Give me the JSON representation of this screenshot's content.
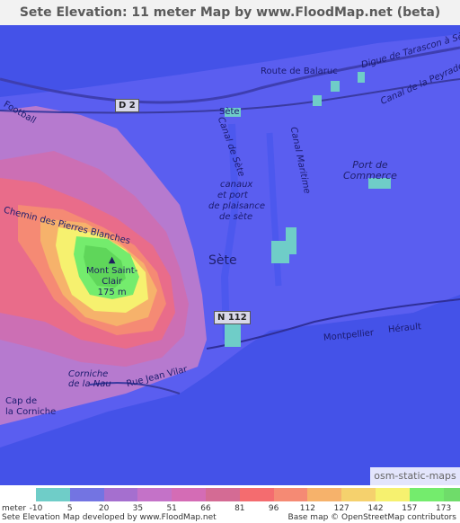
{
  "title": "Sete Elevation: 11 meter Map by www.FloodMap.net (beta)",
  "map": {
    "labels": {
      "route_balaruc": "Route de Balaruc",
      "digue_tarascon": "Digue de Tarascon à Sète",
      "canal_peyrade": "Canal de la Peyrade",
      "d2": "D 2",
      "sete_top": "Sète",
      "football": "Football",
      "canal_de_sete": "Canal de Sète",
      "canal_maritime": "Canal Maritime",
      "canaux": "canaux",
      "et_port": "et port",
      "de_plaisance": "de plaisance",
      "de_sete": "de sète",
      "port_line1": "Port de",
      "port_line2": "Commerce",
      "pierres_blanches": "Chemin des Pierres Blanches",
      "mont_line1": "Mont Saint-",
      "mont_line2": "Clair",
      "mont_line3": "175 m",
      "sete_center": "Sète",
      "n112": "N 112",
      "montpellier": "Montpellier",
      "herault": "Hérault",
      "corniche_line1": "Corniche",
      "corniche_line2": "de la Nau",
      "jean_vilar": "Rue Jean Vilar",
      "cap_line1": "Cap de",
      "cap_line2": "la Corniche"
    },
    "watermark": "osm-static-maps"
  },
  "legend": {
    "unit": "meter",
    "values": [
      "-10",
      "5",
      "20",
      "35",
      "51",
      "66",
      "81",
      "96",
      "112",
      "127",
      "142",
      "157",
      "173"
    ],
    "colors": [
      "#6fcdc8",
      "#7374e2",
      "#a56fcf",
      "#c472c8",
      "#d46cb5",
      "#d46b94",
      "#f46c6f",
      "#f58a74",
      "#f6b26b",
      "#f5d16d",
      "#f6f16f",
      "#74ec6d",
      "#6fdc6a"
    ],
    "footer_left": "Sete Elevation Map developed by www.FloodMap.net",
    "footer_right": "Base map © OpenStreetMap contributors"
  }
}
